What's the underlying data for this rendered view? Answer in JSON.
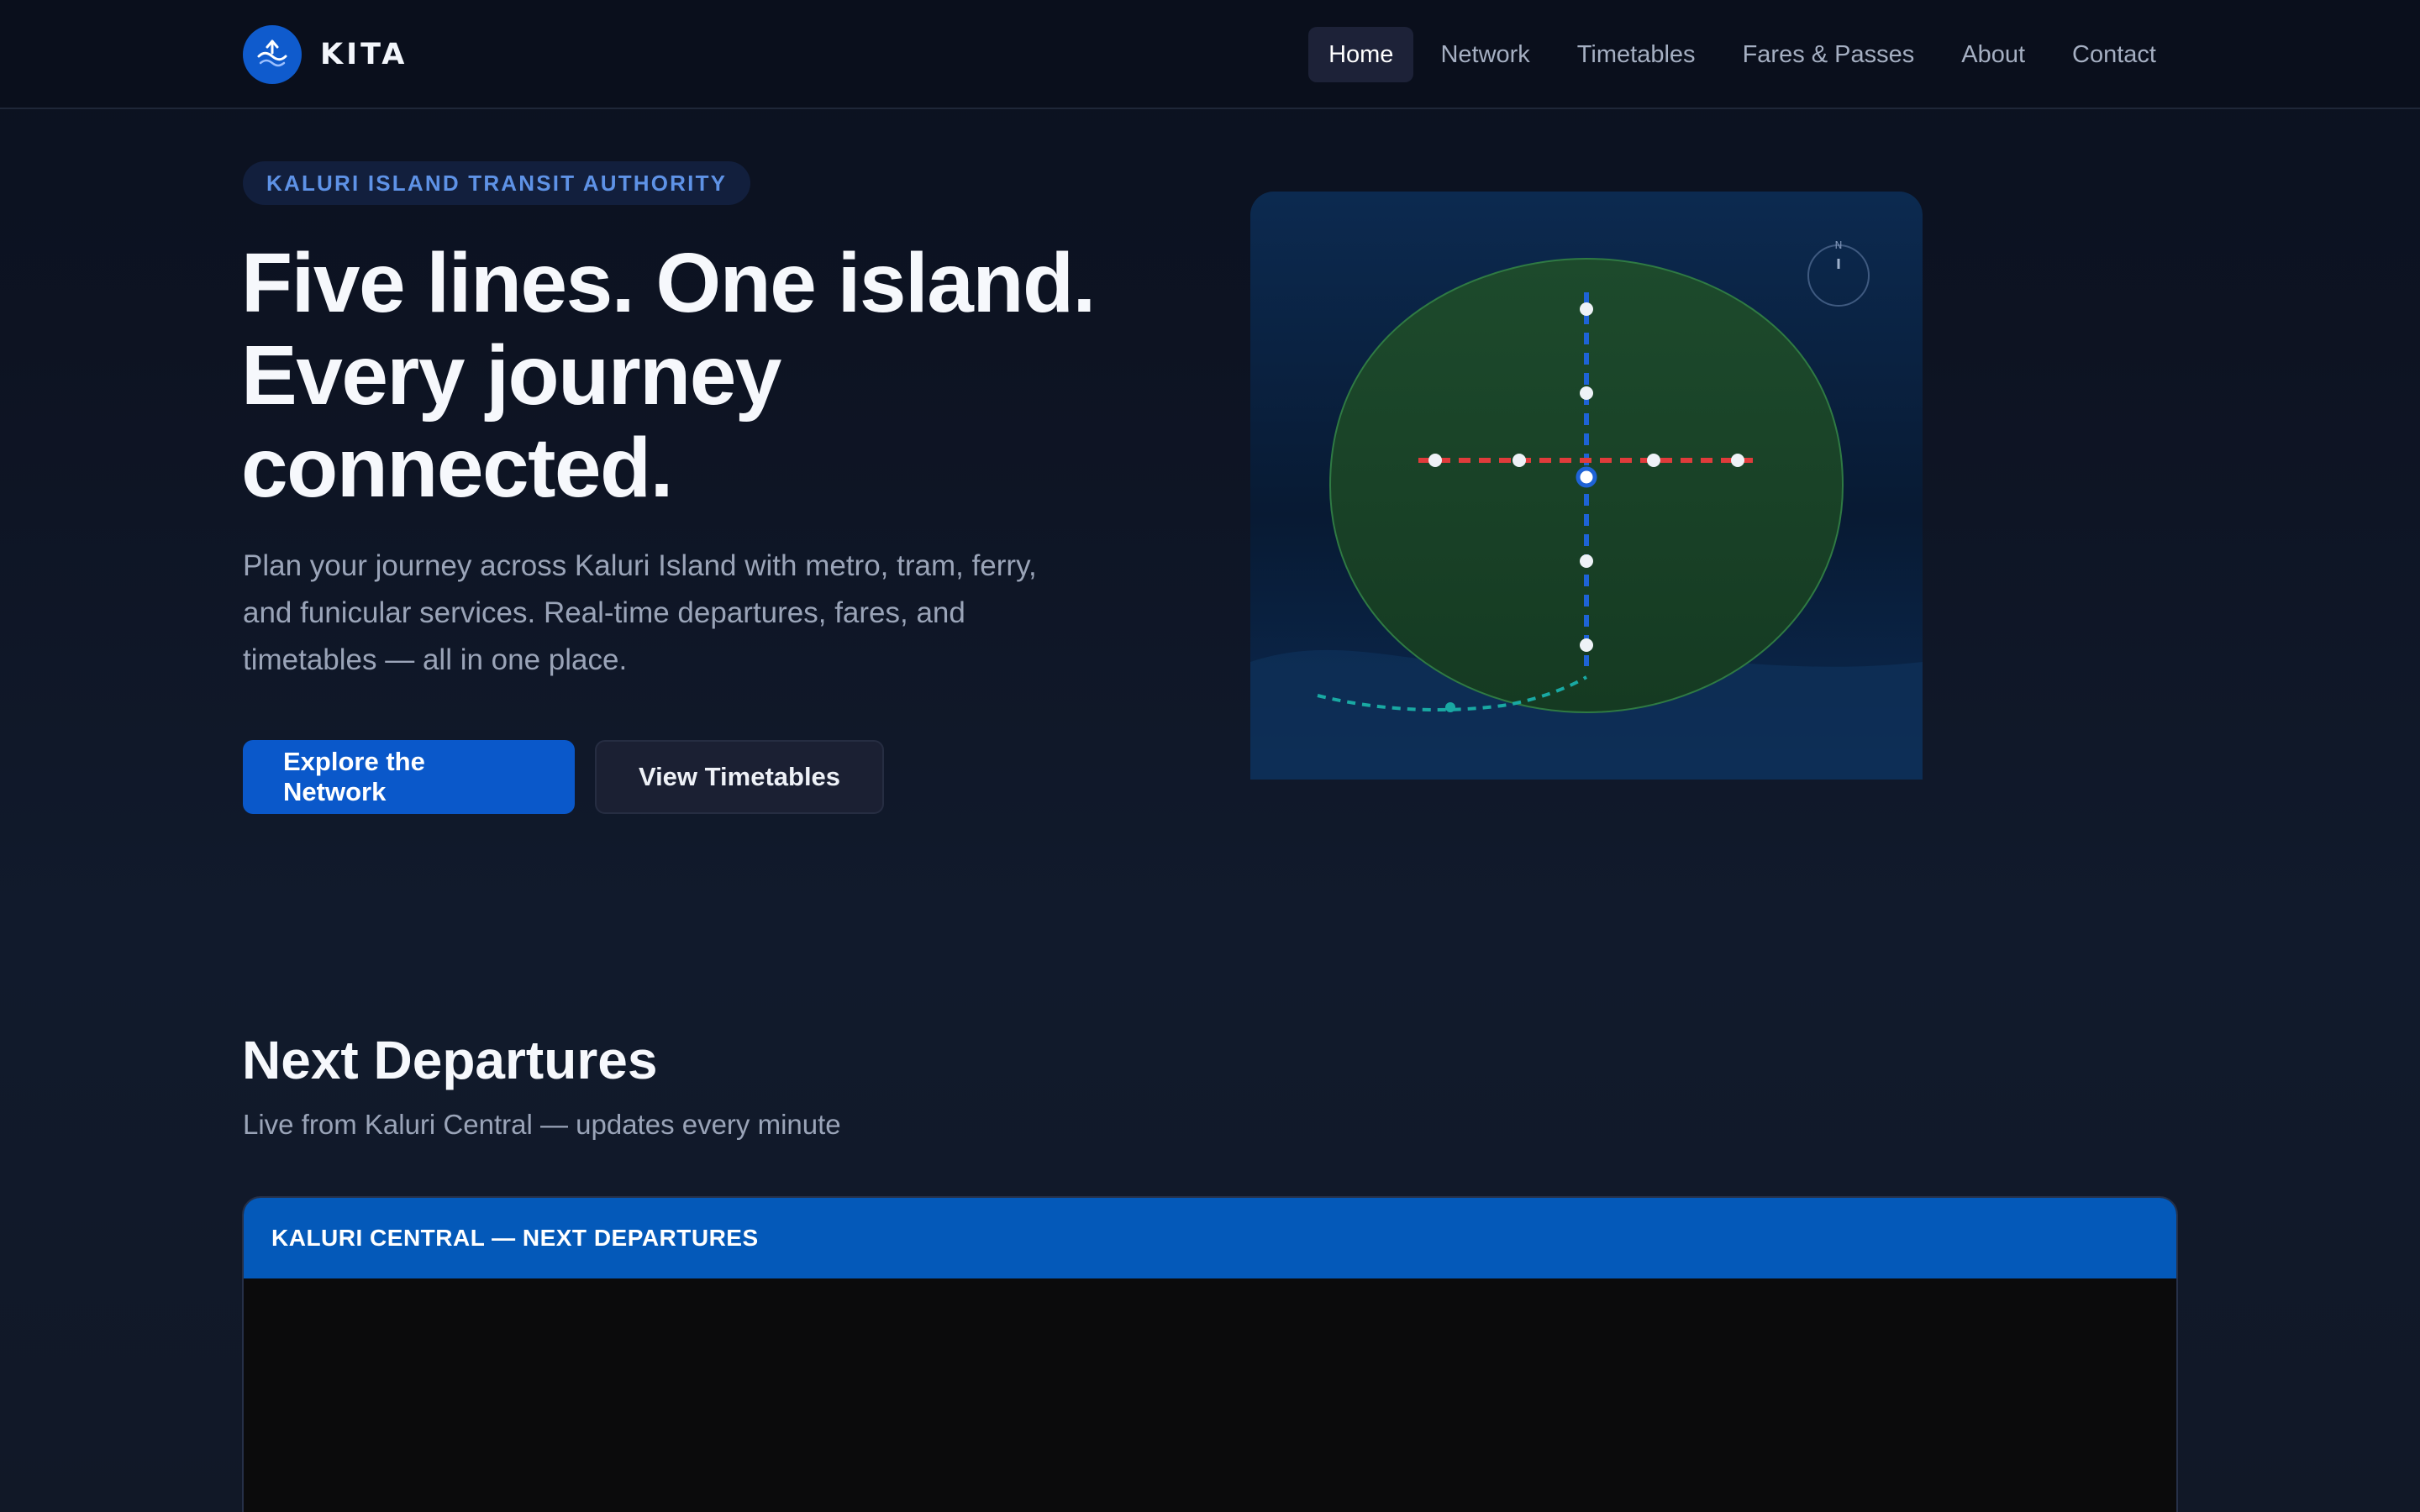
{
  "brand": {
    "name": "KITA",
    "logo_icon": "wave-boat-icon"
  },
  "nav": {
    "items": [
      {
        "label": "Home",
        "active": true
      },
      {
        "label": "Network",
        "active": false
      },
      {
        "label": "Timetables",
        "active": false
      },
      {
        "label": "Fares & Passes",
        "active": false
      },
      {
        "label": "About",
        "active": false
      },
      {
        "label": "Contact",
        "active": false
      }
    ]
  },
  "hero": {
    "eyebrow": "KALURI ISLAND TRANSIT AUTHORITY",
    "title_lines": [
      "Five lines. One island.",
      "Every journey",
      "connected."
    ],
    "subtitle": "Plan your journey across Kaluri Island with metro, tram, ferry, and funicular services. Real-time departures, fares, and timetables — all in one place.",
    "primary_button": "Explore the Network",
    "secondary_button": "View Timetables"
  },
  "map": {
    "compass_label": "N",
    "line_colors": {
      "north_south": "#1e63d6",
      "east_west": "#e03b3b",
      "ferry": "#19a9a3"
    }
  },
  "departures": {
    "title": "Next Departures",
    "subtitle": "Live from Kaluri Central — updates every minute",
    "board_title": "KALURI CENTRAL — NEXT DEPARTURES"
  },
  "colors": {
    "accent": "#0a58ca",
    "background": "#111827"
  }
}
